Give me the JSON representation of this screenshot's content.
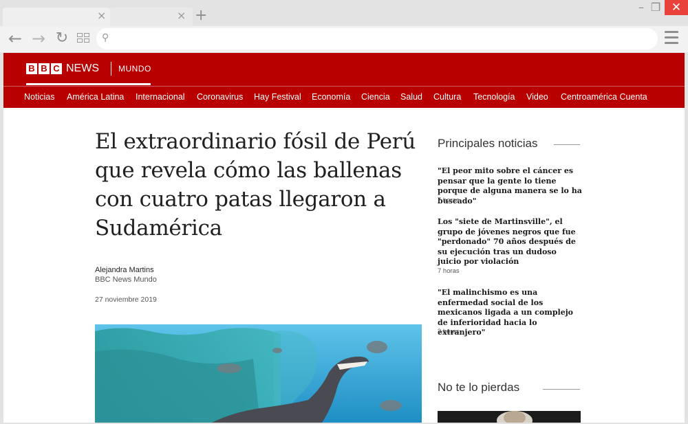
{
  "browser": {
    "tabs": [
      {
        "close": "×"
      },
      {
        "close": "×"
      }
    ],
    "new_tab": "+",
    "window": {
      "minimize": "–",
      "restore": "❐",
      "close": "✕"
    },
    "toolbar": {
      "back": "←",
      "forward": "→",
      "reload": "↻",
      "search_icon": "⚲",
      "address": ""
    }
  },
  "header": {
    "logo_letters": [
      "B",
      "B",
      "C"
    ],
    "logo_news": "NEWS",
    "service": "MUNDO"
  },
  "nav": {
    "items": [
      "Noticias",
      "América Latina",
      "Internacional",
      "Coronavirus",
      "Hay Festival",
      "Economía",
      "Ciencia",
      "Salud",
      "Cultura",
      "Tecnología",
      "Video",
      "Centroamérica Cuenta"
    ]
  },
  "article": {
    "headline": "El extraordinario fósil de Perú que revela cómo las ballenas con cuatro patas llegaron a Sudamérica",
    "author": "Alejandra Martins",
    "source": "BBC News Mundo",
    "date": "27 noviembre 2019"
  },
  "sidebar": {
    "top_title": "Principales noticias",
    "stories": [
      {
        "title": "\"El peor mito sobre el cáncer es pensar que la gente lo tiene porque de alguna manera se lo ha buscado\"",
        "time": "7 horas"
      },
      {
        "title": "Los \"siete de Martinsville\", el grupo de jóvenes negros que fue \"perdonado\" 70 años después de su ejecución tras un dudoso juicio por violación",
        "time": "7 horas"
      },
      {
        "title": "\"El malinchismo es una enfermedad social de los mexicanos ligada a un complejo de inferioridad hacia lo extranjero\"",
        "time": "3 horas"
      }
    ],
    "second_title": "No te lo pierdas"
  },
  "colors": {
    "brand": "#b80000",
    "close": "#e9423b"
  }
}
